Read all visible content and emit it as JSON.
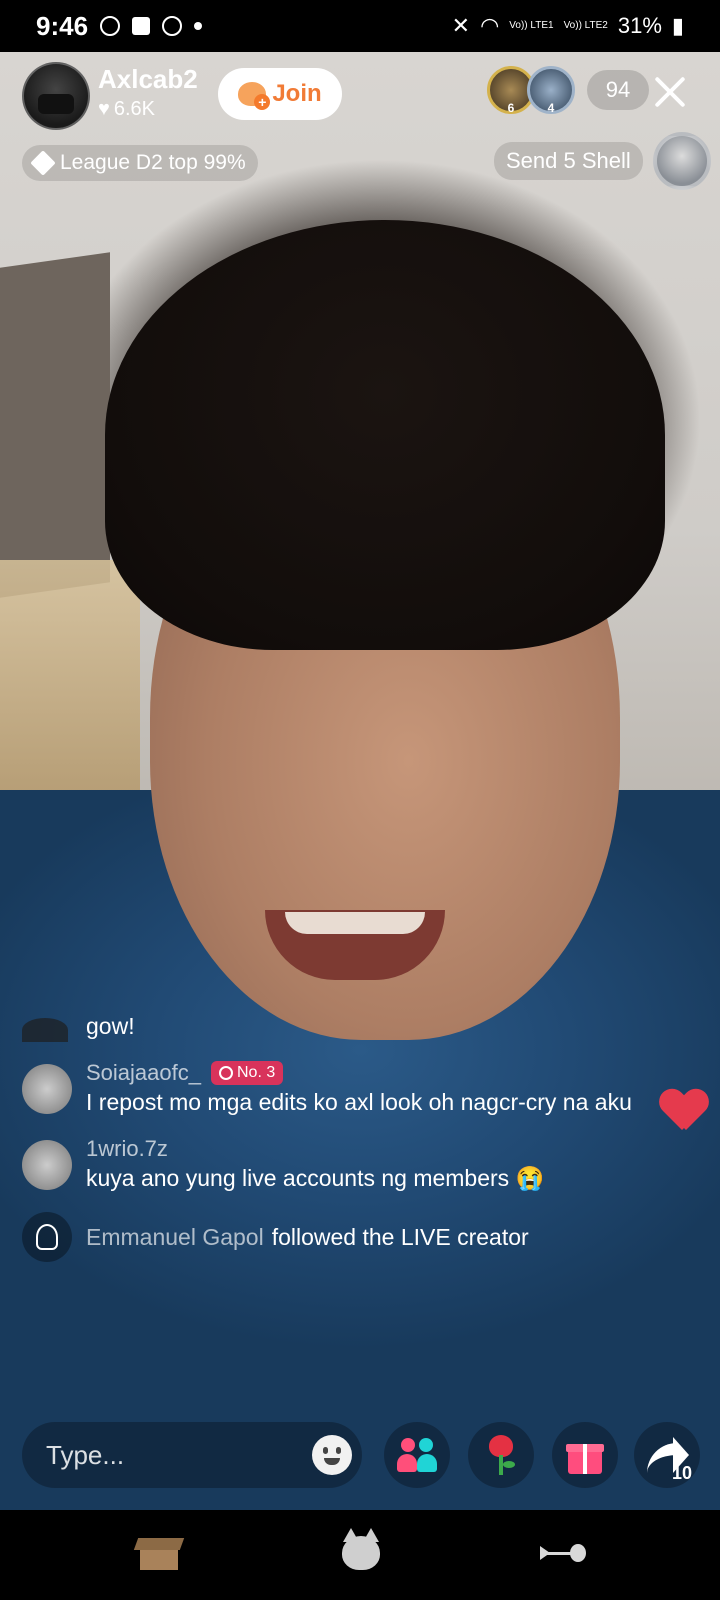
{
  "status_bar": {
    "time": "9:46",
    "battery": "31%",
    "sim1": "Vo)) LTE1",
    "sim2": "Vo)) LTE2"
  },
  "header": {
    "host_name": "Axlcab2",
    "likes": "6.6K",
    "join_label": "Join",
    "top_viewers": [
      {
        "rank": "6"
      },
      {
        "rank": "4"
      }
    ],
    "viewer_count": "94",
    "league": "League D2 top 99%",
    "send_shell": "Send 5 Shell"
  },
  "chat": {
    "messages": [
      {
        "user": "",
        "text": "gow!"
      },
      {
        "user": "Soiajaaofc_",
        "badge": "No. 3",
        "text": "I repost mo mga edits ko axl look oh nagcr-cry na aku"
      },
      {
        "user": "1wrio.7z",
        "text": "kuya ano yung live accounts ng members 😭"
      }
    ],
    "follow": {
      "name": "Emmanuel Gapol",
      "action": "followed the LIVE creator"
    }
  },
  "controls": {
    "type_placeholder": "Type...",
    "share_count": "10"
  },
  "icons": {
    "join": "heart-plus-icon",
    "close": "close-icon",
    "league": "diamond-icon",
    "shell": "shell-icon",
    "emoji": "emoji-icon",
    "multi_guest": "multi-guest-icon",
    "rose": "rose-icon",
    "gift": "gift-icon",
    "share": "share-icon"
  },
  "colors": {
    "join_text": "#f17b36",
    "badge": "#d8335b",
    "heart": "#e53a4d"
  }
}
